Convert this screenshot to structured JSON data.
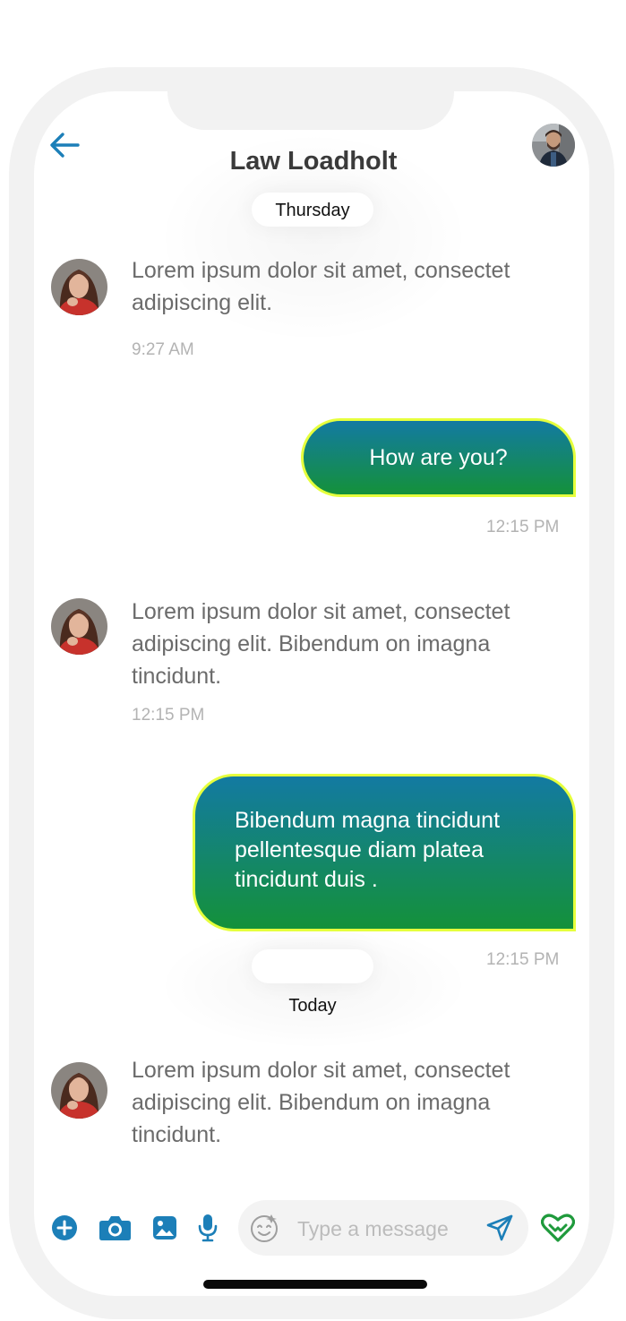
{
  "header": {
    "contact_name": "Law Loadholt",
    "back_icon": "arrow-left-icon",
    "accent_color": "#1c7fb8"
  },
  "days": {
    "first": "Thursday",
    "second": "Today"
  },
  "messages": [
    {
      "direction": "incoming",
      "text": "Lorem ipsum dolor sit amet, consectet adipiscing elit.",
      "time": "9:27 AM"
    },
    {
      "direction": "outgoing",
      "text": "How are you?",
      "time": "12:15 PM"
    },
    {
      "direction": "incoming",
      "text": "Lorem ipsum dolor sit amet, consectet adipiscing elit. Bibendum on imagna tincidunt.",
      "time": "12:15 PM"
    },
    {
      "direction": "outgoing",
      "text": "Bibendum magna tincidunt pellentesque diam platea tincidunt duis .",
      "time": "12:15 PM"
    },
    {
      "direction": "incoming",
      "text": "Lorem ipsum dolor sit amet, consectet adipiscing elit. Bibendum on imagna tincidunt."
    }
  ],
  "composer": {
    "placeholder": "Type a message",
    "icons": [
      "plus-circle-icon",
      "camera-icon",
      "image-icon",
      "microphone-icon",
      "emoji-icon",
      "send-icon",
      "heart-icon"
    ]
  },
  "colors": {
    "bubble_gradient_top": "#137aa2",
    "bubble_gradient_bottom": "#14913a",
    "bubble_border": "#e6ff3d",
    "heart": "#1f9a3c"
  }
}
